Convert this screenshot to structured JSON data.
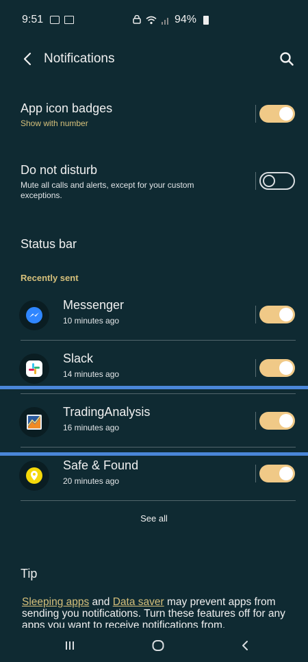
{
  "status_bar": {
    "time": "9:51",
    "battery": "94%"
  },
  "header": {
    "title": "Notifications",
    "back_icon": "chevron-left-icon",
    "search_icon": "search-icon"
  },
  "settings": {
    "app_icon_badges": {
      "title": "App icon badges",
      "subtitle": "Show with number",
      "enabled": true
    },
    "do_not_disturb": {
      "title": "Do not disturb",
      "subtitle": "Mute all calls and alerts, except for your custom exceptions.",
      "enabled": false
    },
    "status_bar": {
      "title": "Status bar"
    }
  },
  "recently_sent": {
    "label": "Recently sent",
    "apps": [
      {
        "name": "Messenger",
        "time": "10 minutes ago",
        "icon": "messenger-icon",
        "enabled": true
      },
      {
        "name": "Slack",
        "time": "14 minutes ago",
        "icon": "slack-icon",
        "enabled": true
      },
      {
        "name": "TradingAnalysis",
        "time": "16 minutes ago",
        "icon": "trading-analysis-icon",
        "enabled": true
      },
      {
        "name": "Safe & Found",
        "time": "20 minutes ago",
        "icon": "safe-found-icon",
        "enabled": true
      }
    ],
    "see_all": "See all"
  },
  "tip": {
    "label": "Tip",
    "link1": "Sleeping apps",
    "text1": " and ",
    "link2": "Data saver",
    "text2": " may prevent apps from sending you notifications. Turn these features off for any apps you want to receive notifications from."
  },
  "colors": {
    "background": "#0f2a32",
    "accent": "#f0c987",
    "subtitle": "#d6c07b",
    "highlight_line": "#4a86d8"
  }
}
